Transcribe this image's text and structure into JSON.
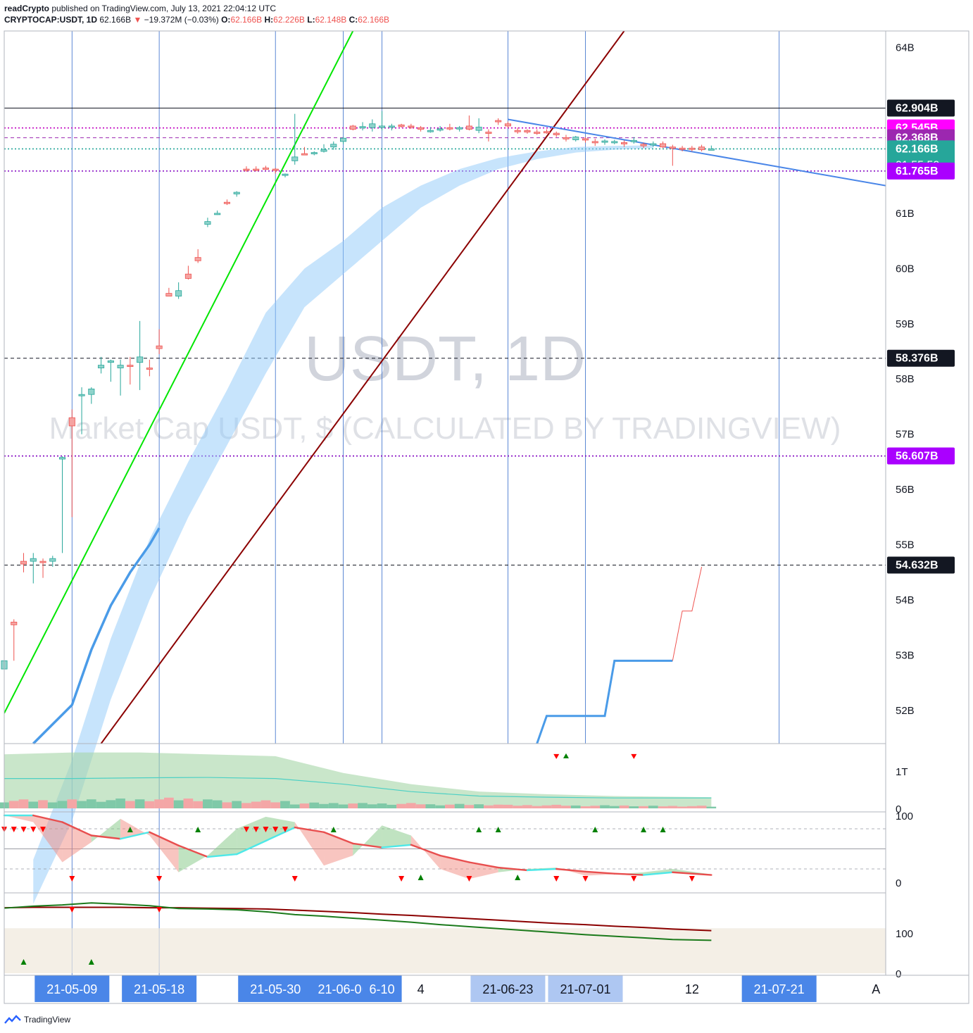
{
  "header": {
    "author": "readCrypto",
    "published_text": "published on TradingView.com, July 13, 2021 22:04:12 UTC",
    "symbol": "CRYPTOCAP:USDT, 1D",
    "last": "62.166B",
    "change_arrow": "▼",
    "change": "−19.372M (−0.03%)",
    "open_label": "O:",
    "open": "62.166B",
    "high_label": "H:",
    "high": "62.226B",
    "low_label": "L:",
    "low": "62.148B",
    "close_label": "C:",
    "close": "62.166B"
  },
  "watermark": {
    "ticker": "USDT, 1D",
    "description": "Market Cap USDT, $ (CALCULATED BY TRADINGVIEW)"
  },
  "footer": {
    "brand": "TradingView"
  },
  "colors": {
    "up": "#26a69a",
    "down": "#ef5350",
    "ribbon": "#90caf9",
    "green_line": "#00e600",
    "dark_red_line": "#8b0000",
    "magenta": "#ff00ff",
    "purple": "#9c27b0",
    "blue": "#4285f4"
  },
  "chart_data": {
    "type": "candlestick",
    "x_range": [
      "2021-05-02",
      "2021-08-01"
    ],
    "y_range": [
      51.4,
      64.3
    ],
    "y_ticks": [
      {
        "v": 64,
        "label": "64B"
      },
      {
        "v": 61,
        "label": "61B"
      },
      {
        "v": 60,
        "label": "60B"
      },
      {
        "v": 59,
        "label": "59B"
      },
      {
        "v": 58,
        "label": "58B"
      },
      {
        "v": 57,
        "label": "57B"
      },
      {
        "v": 56,
        "label": "56B"
      },
      {
        "v": 55,
        "label": "55B"
      },
      {
        "v": 54,
        "label": "54B"
      },
      {
        "v": 53,
        "label": "53B"
      },
      {
        "v": 52,
        "label": "52B"
      }
    ],
    "price_tags": [
      {
        "v": 62.904,
        "label": "62.904B",
        "bg": "#131722",
        "fg": "#ffffff",
        "line": "solid",
        "line_color": "#131722"
      },
      {
        "v": 62.545,
        "label": "62.545B",
        "bg": "#ff00ff",
        "fg": "#ffffff",
        "line": "dotted",
        "line_color": "#c000c0"
      },
      {
        "v": 62.368,
        "label": "62.368B",
        "bg": "#9c27b0",
        "fg": "#ffffff",
        "line": "dashed",
        "line_color": "#9c27b0"
      },
      {
        "v": 62.166,
        "label": "62.166B",
        "label2": "01:55:50",
        "bg": "#26a69a",
        "fg": "#ffffff",
        "line": "dotted",
        "line_color": "#26a69a"
      },
      {
        "v": 61.765,
        "label": "61.765B",
        "bg": "#aa00ff",
        "fg": "#ffffff",
        "line": "dotted",
        "line_color": "#8000c0"
      },
      {
        "v": 58.376,
        "label": "58.376B",
        "bg": "#131722",
        "fg": "#ffffff",
        "line": "dashed",
        "line_color": "#131722"
      },
      {
        "v": 56.607,
        "label": "56.607B",
        "bg": "#aa00ff",
        "fg": "#ffffff",
        "line": "dotted",
        "line_color": "#8000c0"
      },
      {
        "v": 54.632,
        "label": "54.632B",
        "bg": "#131722",
        "fg": "#ffffff",
        "line": "dashed",
        "line_color": "#131722"
      }
    ],
    "vertical_lines": [
      "2021-05-09",
      "2021-05-18",
      "2021-05-30",
      "2021-06-06",
      "2021-06-10",
      "2021-06-23",
      "2021-07-01",
      "2021-07-21"
    ],
    "x_labels": [
      {
        "date": "2021-05-09",
        "label": "21-05-09",
        "style": "blue"
      },
      {
        "date": "2021-05-18",
        "label": "21-05-18",
        "style": "blue"
      },
      {
        "date": "2021-05-30",
        "label": "21-05-30",
        "style": "blue"
      },
      {
        "date": "2021-06-06",
        "label": "21-06-06",
        "style": "blue"
      },
      {
        "date": "2021-06-10",
        "label": "6-10",
        "style": "blue"
      },
      {
        "date": "2021-06-14",
        "label": "4",
        "style": "plain"
      },
      {
        "date": "2021-06-23",
        "label": "21-06-23",
        "style": "light"
      },
      {
        "date": "2021-07-01",
        "label": "21-07-01",
        "style": "light"
      },
      {
        "date": "2021-07-12",
        "label": "12",
        "style": "plain"
      },
      {
        "date": "2021-07-21",
        "label": "21-07-21",
        "style": "blue"
      },
      {
        "date": "2021-07-31",
        "label": "A",
        "style": "plain"
      }
    ],
    "candles": [
      [
        "2021-05-02",
        52.75,
        52.95,
        52.55,
        52.9
      ],
      [
        "2021-05-03",
        53.6,
        53.65,
        52.9,
        53.55
      ],
      [
        "2021-05-04",
        54.7,
        54.85,
        54.5,
        54.65
      ],
      [
        "2021-05-05",
        54.7,
        54.85,
        54.3,
        54.75
      ],
      [
        "2021-05-06",
        54.7,
        54.75,
        54.4,
        54.68
      ],
      [
        "2021-05-07",
        54.7,
        54.8,
        54.6,
        54.75
      ],
      [
        "2021-05-08",
        56.55,
        56.6,
        54.85,
        56.58
      ],
      [
        "2021-05-09",
        57.3,
        57.45,
        55.5,
        57.15
      ],
      [
        "2021-05-10",
        57.7,
        57.85,
        57.0,
        57.72
      ],
      [
        "2021-05-11",
        57.72,
        57.85,
        57.55,
        57.82
      ],
      [
        "2021-05-12",
        58.2,
        58.4,
        58.1,
        58.25
      ],
      [
        "2021-05-13",
        58.3,
        58.35,
        57.95,
        58.33
      ],
      [
        "2021-05-14",
        58.2,
        58.35,
        57.7,
        58.25
      ],
      [
        "2021-05-15",
        58.25,
        58.4,
        57.9,
        58.23
      ],
      [
        "2021-05-16",
        58.3,
        59.05,
        57.8,
        58.4
      ],
      [
        "2021-05-17",
        58.2,
        58.35,
        58.05,
        58.18
      ],
      [
        "2021-05-18",
        58.6,
        58.9,
        58.45,
        58.55
      ],
      [
        "2021-05-19",
        59.55,
        59.65,
        59.5,
        59.5
      ],
      [
        "2021-05-20",
        59.5,
        59.75,
        59.45,
        59.6
      ],
      [
        "2021-05-21",
        59.9,
        60.05,
        59.8,
        59.82
      ],
      [
        "2021-05-22",
        60.2,
        60.35,
        60.1,
        60.14
      ],
      [
        "2021-05-23",
        60.8,
        60.92,
        60.75,
        60.85
      ],
      [
        "2021-05-24",
        61.0,
        61.05,
        60.97,
        61.0
      ],
      [
        "2021-05-25",
        61.2,
        61.25,
        61.15,
        61.18
      ],
      [
        "2021-05-26",
        61.35,
        61.4,
        61.3,
        61.38
      ],
      [
        "2021-05-27",
        61.8,
        61.85,
        61.75,
        61.78
      ],
      [
        "2021-05-28",
        61.8,
        61.85,
        61.76,
        61.79
      ],
      [
        "2021-05-29",
        61.82,
        61.86,
        61.78,
        61.8
      ],
      [
        "2021-05-30",
        61.8,
        61.82,
        61.72,
        61.78
      ],
      [
        "2021-05-31",
        61.7,
        61.72,
        61.65,
        61.71
      ],
      [
        "2021-06-01",
        61.95,
        62.8,
        61.88,
        62.02
      ],
      [
        "2021-06-02",
        62.08,
        62.2,
        62.05,
        62.06
      ],
      [
        "2021-06-03",
        62.1,
        62.12,
        62.05,
        62.1
      ],
      [
        "2021-06-04",
        62.12,
        62.25,
        62.1,
        62.15
      ],
      [
        "2021-06-05",
        62.2,
        62.3,
        62.15,
        62.25
      ],
      [
        "2021-06-06",
        62.3,
        62.38,
        62.25,
        62.36
      ],
      [
        "2021-06-07",
        62.58,
        62.6,
        62.5,
        62.52
      ],
      [
        "2021-06-08",
        62.55,
        62.65,
        62.5,
        62.57
      ],
      [
        "2021-06-09",
        62.55,
        62.7,
        62.48,
        62.62
      ],
      [
        "2021-06-10",
        62.55,
        62.85,
        62.5,
        62.58
      ],
      [
        "2021-06-11",
        62.58,
        62.62,
        62.5,
        62.58
      ],
      [
        "2021-06-12",
        62.6,
        62.62,
        62.55,
        62.57
      ],
      [
        "2021-06-13",
        62.58,
        62.62,
        62.53,
        62.56
      ],
      [
        "2021-06-14",
        62.55,
        62.58,
        62.48,
        62.52
      ],
      [
        "2021-06-15",
        62.5,
        62.56,
        62.46,
        62.5
      ],
      [
        "2021-06-16",
        62.52,
        62.58,
        62.48,
        62.53
      ],
      [
        "2021-06-17",
        62.55,
        62.62,
        62.5,
        62.53
      ],
      [
        "2021-06-18",
        62.53,
        62.58,
        62.48,
        62.55
      ],
      [
        "2021-06-19",
        62.58,
        62.77,
        62.5,
        62.52
      ],
      [
        "2021-06-20",
        62.5,
        62.72,
        62.45,
        62.56
      ],
      [
        "2021-06-21",
        62.47,
        62.52,
        62.3,
        62.45
      ],
      [
        "2021-06-22",
        62.68,
        62.72,
        62.6,
        62.66
      ],
      [
        "2021-06-23",
        62.62,
        62.66,
        62.55,
        62.58
      ],
      [
        "2021-06-24",
        62.5,
        62.55,
        62.44,
        62.48
      ],
      [
        "2021-06-25",
        62.5,
        62.52,
        62.44,
        62.47
      ],
      [
        "2021-06-26",
        62.47,
        62.52,
        62.42,
        62.45
      ],
      [
        "2021-06-27",
        62.48,
        62.52,
        62.44,
        62.47
      ],
      [
        "2021-06-28",
        62.45,
        62.48,
        62.38,
        62.42
      ],
      [
        "2021-06-29",
        62.37,
        62.42,
        62.3,
        62.35
      ],
      [
        "2021-06-30",
        62.33,
        62.4,
        62.3,
        62.38
      ],
      [
        "2021-07-01",
        62.35,
        62.38,
        62.28,
        62.33
      ],
      [
        "2021-07-02",
        62.3,
        62.35,
        62.22,
        62.29
      ],
      [
        "2021-07-03",
        62.3,
        62.34,
        62.24,
        62.31
      ],
      [
        "2021-07-04",
        62.3,
        62.33,
        62.25,
        62.3
      ],
      [
        "2021-07-05",
        62.28,
        62.32,
        62.2,
        62.26
      ],
      [
        "2021-07-06",
        62.3,
        62.38,
        62.26,
        62.32
      ],
      [
        "2021-07-07",
        62.25,
        62.28,
        62.18,
        62.22
      ],
      [
        "2021-07-08",
        62.24,
        62.3,
        62.2,
        62.26
      ],
      [
        "2021-07-09",
        62.26,
        62.3,
        62.18,
        62.2
      ],
      [
        "2021-07-10",
        62.2,
        62.24,
        61.86,
        62.18
      ],
      [
        "2021-07-11",
        62.18,
        62.22,
        62.12,
        62.17
      ],
      [
        "2021-07-12",
        62.18,
        62.22,
        62.12,
        62.17
      ],
      [
        "2021-07-13",
        62.2,
        62.24,
        62.12,
        62.15
      ],
      [
        "2021-07-14",
        62.166,
        62.226,
        62.148,
        62.166
      ]
    ],
    "ribbon": {
      "x": [
        "2021-05-05",
        "2021-05-09",
        "2021-05-13",
        "2021-05-17",
        "2021-05-21",
        "2021-05-25",
        "2021-05-29",
        "2021-06-02",
        "2021-06-06",
        "2021-06-10",
        "2021-06-14",
        "2021-06-18",
        "2021-06-22",
        "2021-06-26",
        "2021-06-30",
        "2021-07-04",
        "2021-07-08"
      ],
      "upper": [
        49.3,
        51.1,
        53.3,
        55.1,
        56.5,
        57.8,
        59.2,
        60.0,
        60.5,
        61.1,
        61.5,
        61.8,
        62.0,
        62.12,
        62.2,
        62.22,
        62.23
      ],
      "lower": [
        48.5,
        50.0,
        52.2,
        54.0,
        55.5,
        56.8,
        58.1,
        59.3,
        59.9,
        60.5,
        61.1,
        61.5,
        61.8,
        61.98,
        62.1,
        62.15,
        62.18
      ]
    },
    "blue_line": {
      "x": [
        "2021-05-05",
        "2021-05-07",
        "2021-05-09",
        "2021-05-11",
        "2021-05-13",
        "2021-05-15",
        "2021-05-17",
        "2021-05-18"
      ],
      "y": [
        51.4,
        51.75,
        52.1,
        53.1,
        53.9,
        54.5,
        55.0,
        55.3
      ]
    },
    "step_line": {
      "x": [
        "2021-06-26",
        "2021-06-27",
        "2021-07-03",
        "2021-07-04",
        "2021-07-10"
      ],
      "y": [
        51.4,
        51.9,
        51.9,
        52.9,
        52.9
      ]
    },
    "step_red": {
      "x": [
        "2021-07-10",
        "2021-07-11",
        "2021-07-12",
        "2021-07-13"
      ],
      "y": [
        52.9,
        53.8,
        53.8,
        54.6
      ]
    },
    "trend_lines": [
      {
        "x": [
          "2021-05-02",
          "2021-06-07"
        ],
        "y": [
          51.95,
          64.3
        ],
        "color": "#00e600"
      },
      {
        "x": [
          "2021-05-12",
          "2021-07-05"
        ],
        "y": [
          51.4,
          64.3
        ],
        "color": "#8b0000"
      },
      {
        "x": [
          "2021-06-23",
          "2021-08-01"
        ],
        "y": [
          62.7,
          61.5
        ],
        "color": "#4a86e8"
      }
    ],
    "volume_panel": {
      "y_ticks": [
        {
          "v": 1,
          "label": "1T"
        },
        {
          "v": 0,
          "label": "0"
        }
      ],
      "y_range": [
        0,
        1.7
      ],
      "x": [
        "2021-05-02",
        "2021-05-09",
        "2021-05-16",
        "2021-05-23",
        "2021-05-30",
        "2021-06-06",
        "2021-06-13",
        "2021-06-20",
        "2021-06-27",
        "2021-07-04",
        "2021-07-14"
      ],
      "band_upper": [
        1.45,
        1.5,
        1.5,
        1.45,
        1.4,
        0.95,
        0.65,
        0.45,
        0.38,
        0.33,
        0.3
      ],
      "band_mid": [
        0.8,
        0.8,
        0.82,
        0.83,
        0.8,
        0.65,
        0.45,
        0.33,
        0.3,
        0.28,
        0.28
      ],
      "volume_levels": [
        0.2,
        0.22,
        0.24,
        0.18,
        0.13,
        0.12,
        0.1,
        0.08,
        0.07,
        0.06,
        0.05
      ],
      "markers": [
        {
          "date": "2021-06-28",
          "dir": "down",
          "color": "#ff0000"
        },
        {
          "date": "2021-06-29",
          "dir": "up",
          "color": "#008000"
        },
        {
          "date": "2021-07-06",
          "dir": "down",
          "color": "#ff0000"
        }
      ]
    },
    "osc_panel": {
      "y_ticks": [
        {
          "v": 100,
          "label": "100"
        },
        {
          "v": 0,
          "label": "0"
        }
      ],
      "y_range": [
        0,
        100
      ],
      "levels": [
        80,
        50,
        20
      ],
      "x": [
        "2021-05-02",
        "2021-05-05",
        "2021-05-08",
        "2021-05-11",
        "2021-05-14",
        "2021-05-17",
        "2021-05-20",
        "2021-05-23",
        "2021-05-26",
        "2021-05-29",
        "2021-06-01",
        "2021-06-04",
        "2021-06-07",
        "2021-06-10",
        "2021-06-13",
        "2021-06-16",
        "2021-06-19",
        "2021-06-22",
        "2021-06-25",
        "2021-06-28",
        "2021-07-01",
        "2021-07-04",
        "2021-07-07",
        "2021-07-10",
        "2021-07-14"
      ],
      "line": [
        100,
        100,
        90,
        70,
        65,
        75,
        55,
        38,
        42,
        62,
        82,
        75,
        58,
        52,
        56,
        40,
        30,
        22,
        18,
        20,
        16,
        13,
        11,
        15,
        11
      ],
      "fast": [
        100,
        90,
        30,
        60,
        95,
        70,
        15,
        40,
        80,
        98,
        90,
        25,
        40,
        85,
        70,
        20,
        5,
        15,
        20,
        22,
        10,
        12,
        15,
        20,
        12
      ],
      "down_markers": [
        "2021-05-02",
        "2021-05-03",
        "2021-05-04",
        "2021-05-05",
        "2021-05-06",
        "2021-05-27",
        "2021-05-28",
        "2021-05-29",
        "2021-05-30",
        "2021-05-31"
      ],
      "up_markers_top": [
        "2021-05-15",
        "2021-05-22",
        "2021-06-05",
        "2021-06-20",
        "2021-06-22",
        "2021-07-02",
        "2021-07-07",
        "2021-07-09"
      ],
      "down_markers_low": [
        "2021-05-09",
        "2021-05-18",
        "2021-06-01",
        "2021-06-12",
        "2021-06-19",
        "2021-06-28",
        "2021-07-01",
        "2021-07-06",
        "2021-07-12"
      ],
      "up_markers_low": [
        "2021-06-14",
        "2021-06-24"
      ]
    },
    "third_panel": {
      "y_ticks": [
        {
          "v": 100,
          "label": "100"
        },
        {
          "v": 0,
          "label": "0"
        }
      ],
      "y_range": [
        -5,
        200
      ],
      "band": [
        0,
        112
      ],
      "x": [
        "2021-05-02",
        "2021-05-05",
        "2021-05-08",
        "2021-05-11",
        "2021-05-14",
        "2021-05-17",
        "2021-05-20",
        "2021-05-23",
        "2021-05-26",
        "2021-05-29",
        "2021-06-01",
        "2021-06-04",
        "2021-06-07",
        "2021-06-10",
        "2021-06-13",
        "2021-06-16",
        "2021-06-19",
        "2021-06-22",
        "2021-06-25",
        "2021-06-28",
        "2021-07-01",
        "2021-07-04",
        "2021-07-07",
        "2021-07-10",
        "2021-07-14"
      ],
      "dark_red": [
        163,
        164,
        164,
        164,
        164,
        163,
        163,
        162,
        161,
        160,
        157,
        154,
        151,
        147,
        144,
        140,
        136,
        132,
        128,
        124,
        121,
        117,
        114,
        110,
        106
      ],
      "green": [
        162,
        167,
        170,
        175,
        172,
        168,
        161,
        160,
        158,
        153,
        146,
        142,
        137,
        132,
        127,
        121,
        116,
        111,
        106,
        101,
        96,
        92,
        88,
        84,
        82
      ],
      "up_markers": [
        "2021-05-04",
        "2021-05-11"
      ],
      "down_markers": [
        "2021-05-09",
        "2021-05-18"
      ]
    }
  }
}
